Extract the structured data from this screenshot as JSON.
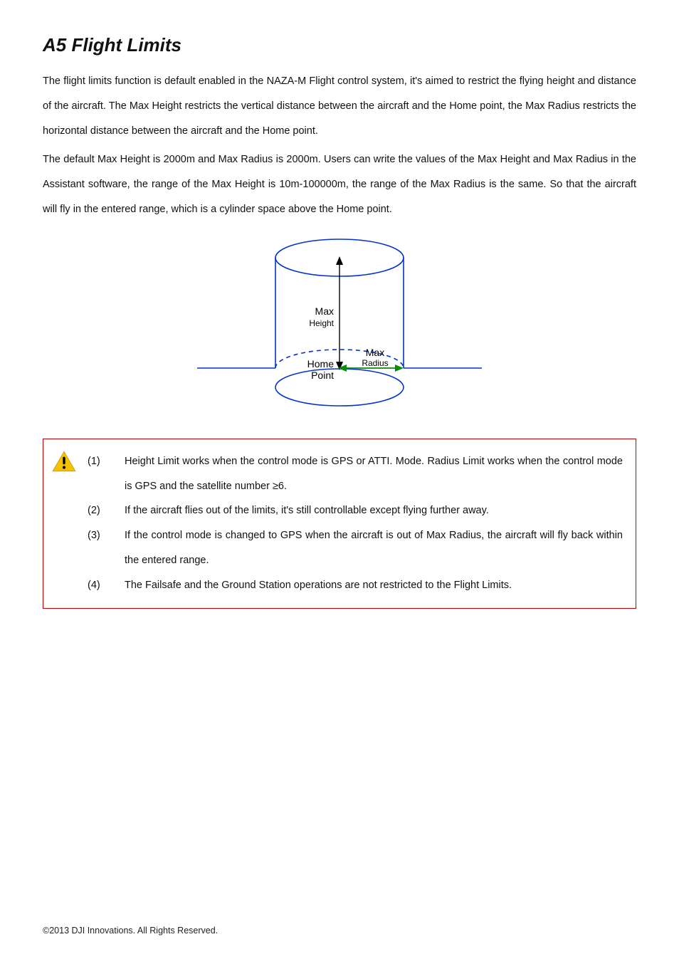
{
  "heading": "A5 Flight Limits",
  "paragraphs": [
    "The flight limits function is default enabled in the NAZA-M Flight control system, it's aimed to restrict the flying height and distance of the aircraft. The Max Height restricts the vertical distance between the aircraft and the Home point, the Max Radius restricts the horizontal distance between the aircraft and the Home point.",
    "The default Max Height is 2000m and Max Radius is 2000m. Users can write the values of the Max Height and Max Radius in the Assistant software, the range of the Max Height is 10m-100000m, the range of the Max Radius is the same. So that the aircraft will fly in the entered range, which is a cylinder space above the Home point."
  ],
  "diagram": {
    "max_height_label_1": "Max",
    "max_height_label_2": "Height",
    "max_radius_label_1": "Max",
    "max_radius_label_2": "Radius",
    "home_label_1": "Home",
    "home_label_2": "Point"
  },
  "notes": [
    {
      "num": "(1)",
      "text": "Height Limit works when the control mode is GPS or ATTI. Mode. Radius Limit works when the control mode is GPS and the satellite number ≥6."
    },
    {
      "num": "(2)",
      "text": "If the aircraft flies out of the limits, it's still controllable except flying further away."
    },
    {
      "num": "(3)",
      "text": "If the control mode is changed to GPS when the aircraft is out of Max Radius, the aircraft will fly back within the entered range."
    },
    {
      "num": "(4)",
      "text": "The Failsafe and the Ground Station operations are not restricted to the Flight Limits."
    }
  ],
  "footer": "©2013 DJI Innovations. All Rights Reserved."
}
